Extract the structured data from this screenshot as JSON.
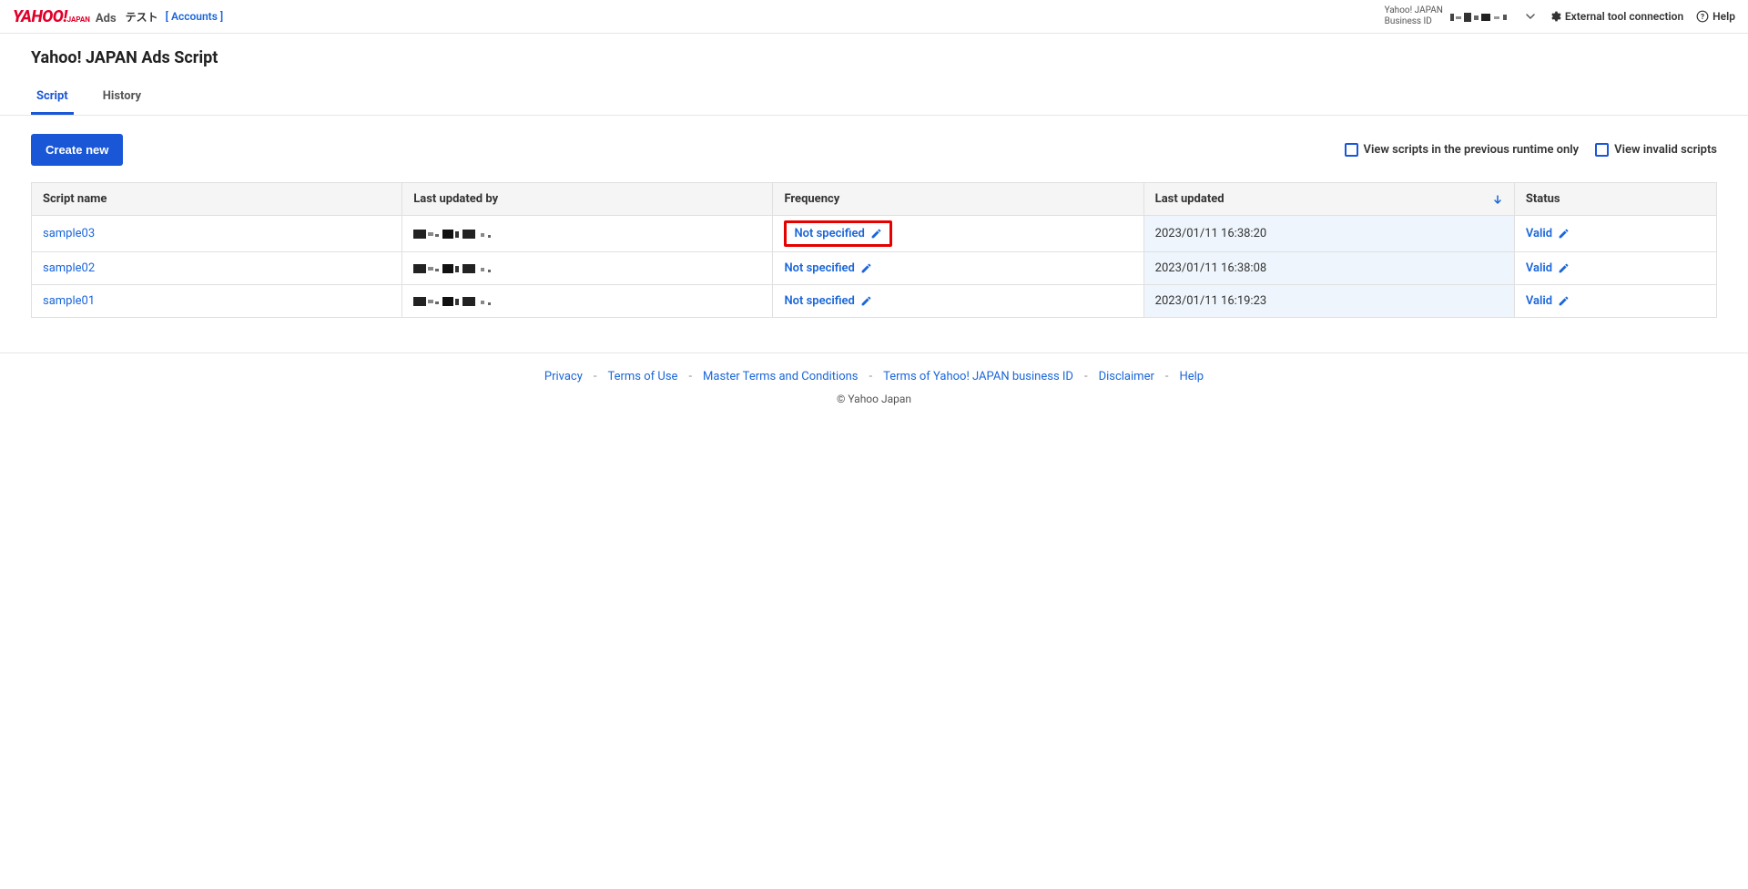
{
  "topbar": {
    "logo_ads_label": "Ads",
    "test_label": "テスト",
    "accounts_label": "[ Accounts ]",
    "biz_id_label_line1": "Yahoo! JAPAN",
    "biz_id_label_line2": "Business ID",
    "external_tool_label": "External tool connection",
    "help_label": "Help"
  },
  "page": {
    "title": "Yahoo! JAPAN Ads Script",
    "tabs": [
      {
        "label": "Script",
        "active": true
      },
      {
        "label": "History",
        "active": false
      }
    ]
  },
  "toolbar": {
    "create_button": "Create new",
    "filter_prev_runtime": "View scripts in the previous runtime only",
    "filter_invalid": "View invalid scripts"
  },
  "table": {
    "headers": {
      "script_name": "Script name",
      "last_updated_by": "Last updated by",
      "frequency": "Frequency",
      "last_updated": "Last updated",
      "status": "Status"
    },
    "rows": [
      {
        "script_name": "sample03",
        "frequency": "Not specified",
        "frequency_highlight": true,
        "last_updated": "2023/01/11 16:38:20",
        "status": "Valid"
      },
      {
        "script_name": "sample02",
        "frequency": "Not specified",
        "frequency_highlight": false,
        "last_updated": "2023/01/11 16:38:08",
        "status": "Valid"
      },
      {
        "script_name": "sample01",
        "frequency": "Not specified",
        "frequency_highlight": false,
        "last_updated": "2023/01/11 16:19:23",
        "status": "Valid"
      }
    ]
  },
  "footer": {
    "links": [
      "Privacy",
      "Terms of Use",
      "Master Terms and Conditions",
      "Terms of Yahoo! JAPAN business ID",
      "Disclaimer",
      "Help"
    ],
    "copyright": "© Yahoo Japan"
  }
}
